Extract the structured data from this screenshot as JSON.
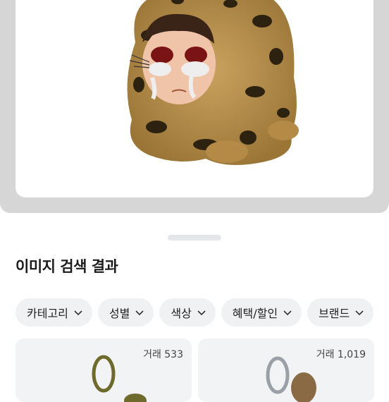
{
  "results": {
    "title": "이미지 검색 결과"
  },
  "filters": [
    {
      "label": "카테고리"
    },
    {
      "label": "성별"
    },
    {
      "label": "색상"
    },
    {
      "label": "혜택/할인"
    },
    {
      "label": "브랜드"
    }
  ],
  "products": [
    {
      "trades": "거래 533"
    },
    {
      "trades": "거래 1,019"
    }
  ]
}
